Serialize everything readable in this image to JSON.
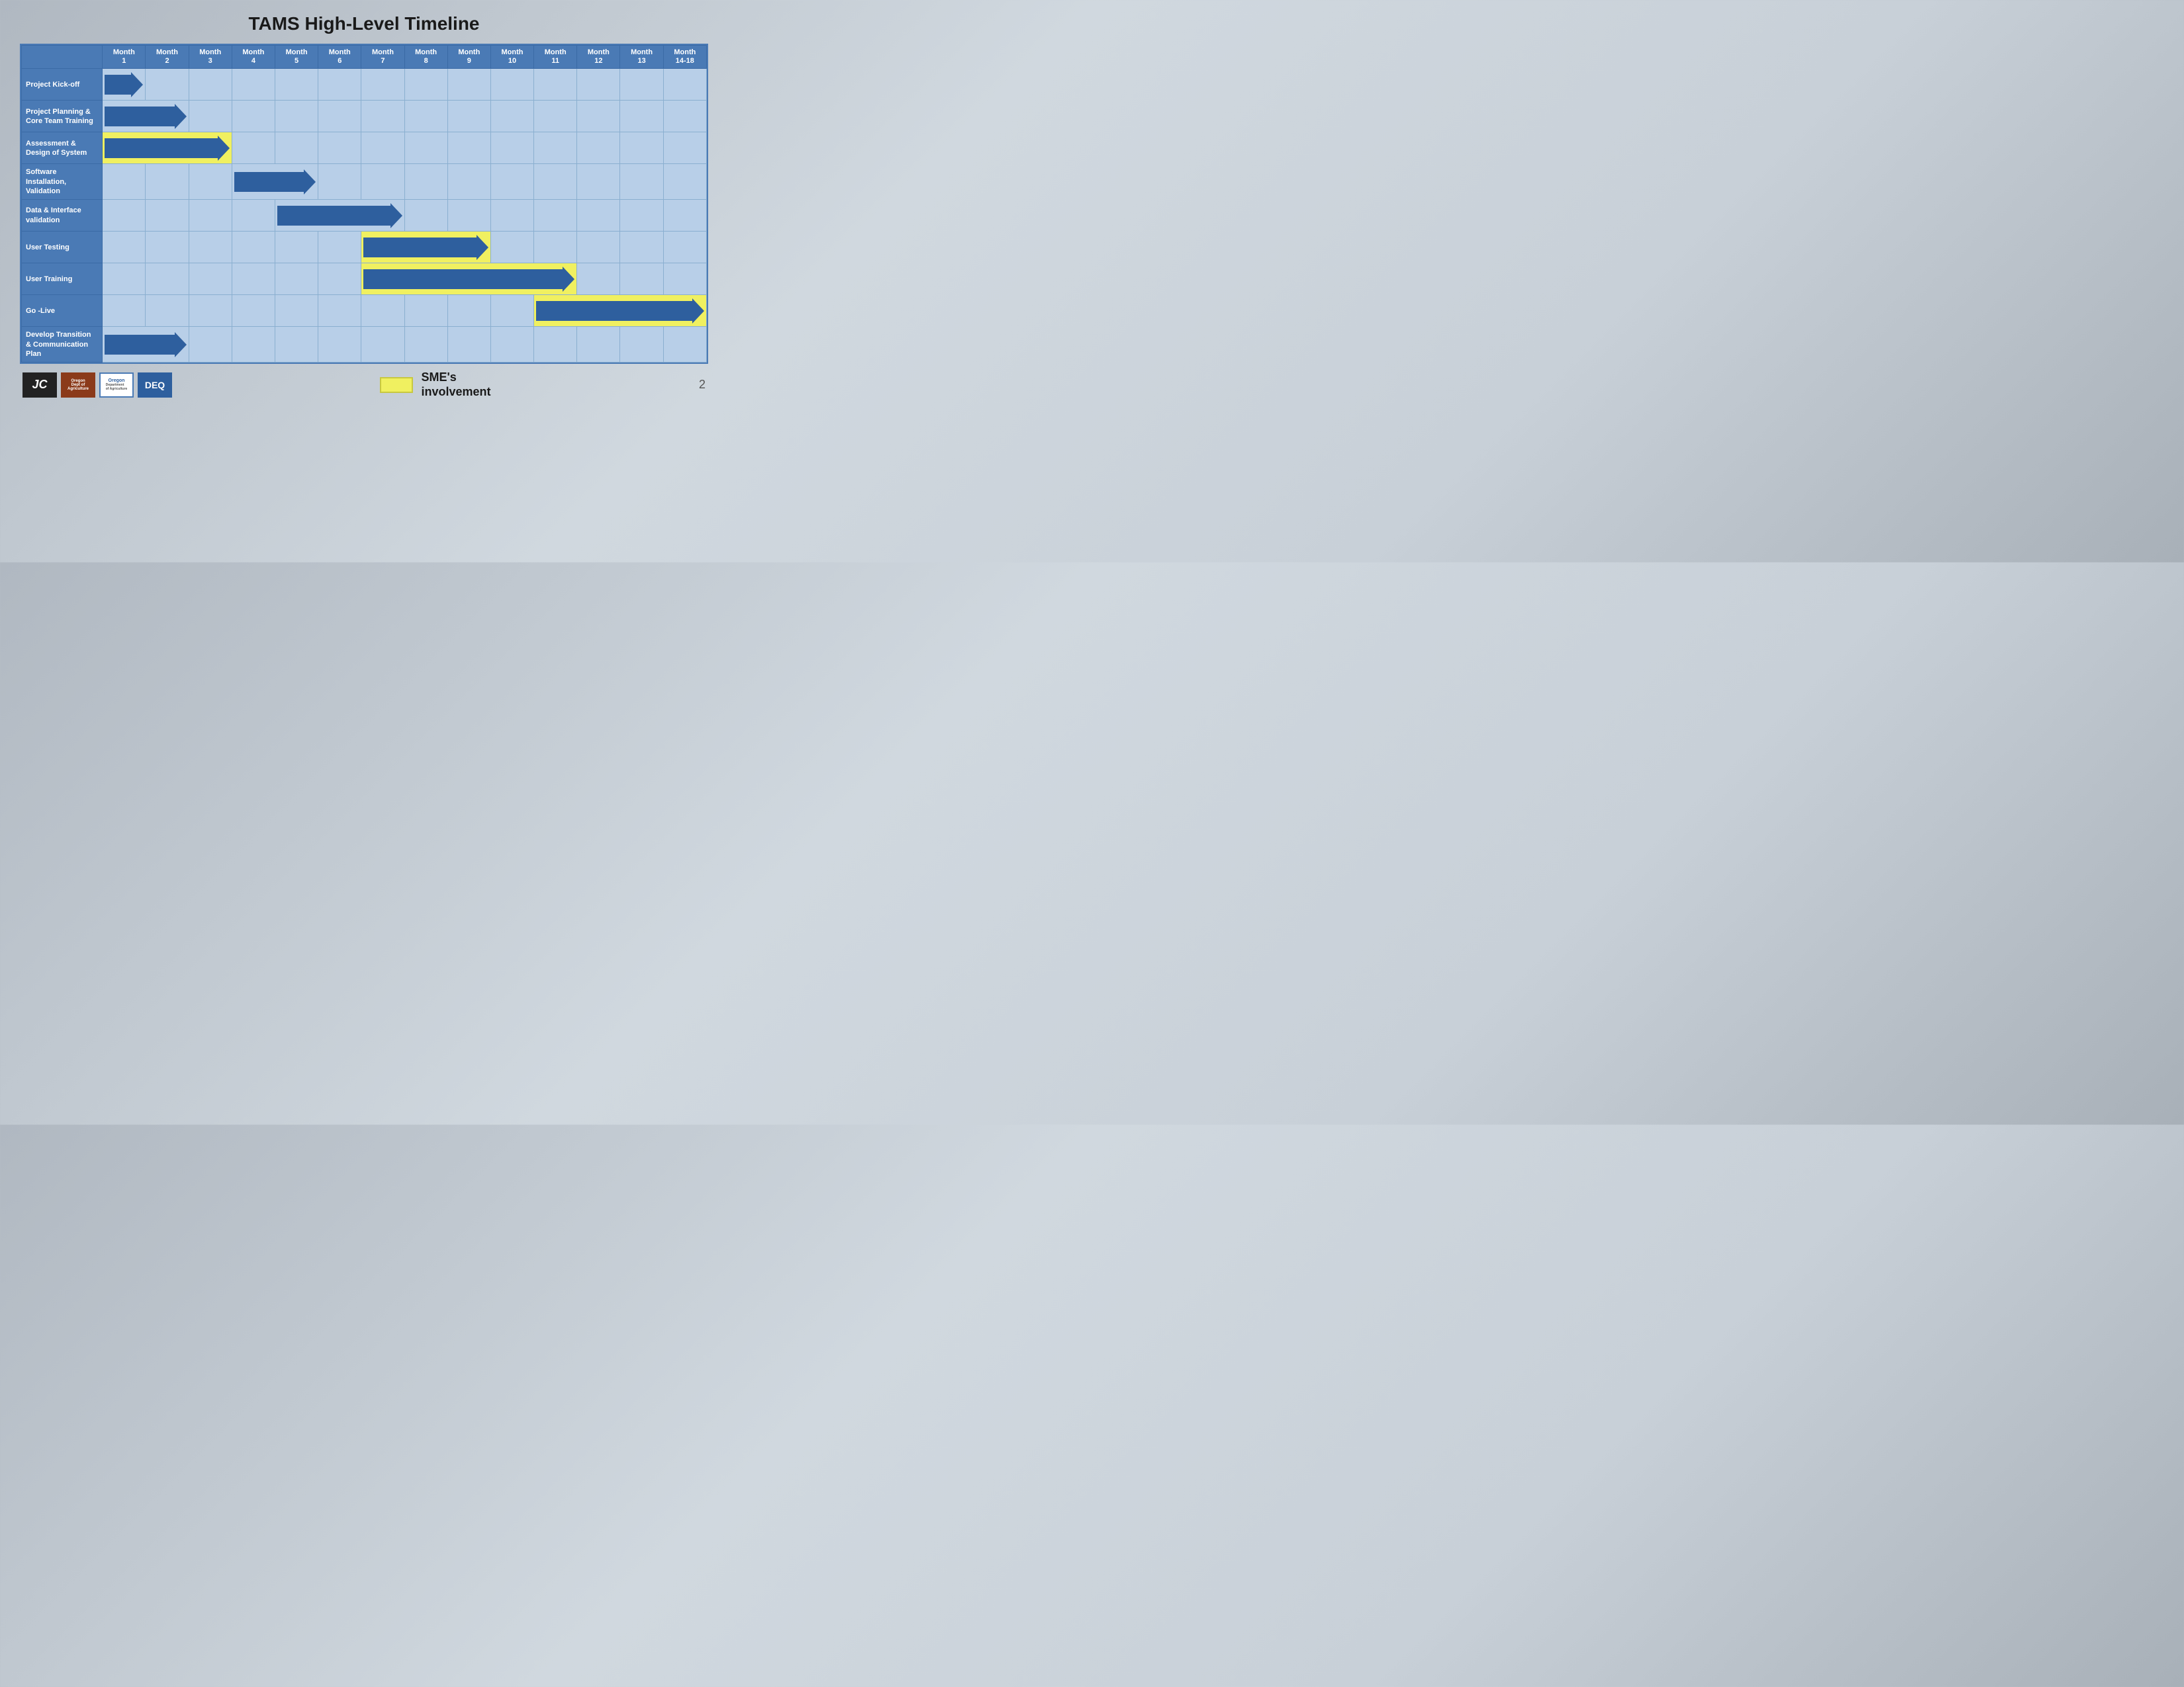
{
  "title": "TAMS High-Level Timeline",
  "months": [
    {
      "label": "Month",
      "sub": "1"
    },
    {
      "label": "Month",
      "sub": "2"
    },
    {
      "label": "Month",
      "sub": "3"
    },
    {
      "label": "Month",
      "sub": "4"
    },
    {
      "label": "Month",
      "sub": "5"
    },
    {
      "label": "Month",
      "sub": "6"
    },
    {
      "label": "Month",
      "sub": "7"
    },
    {
      "label": "Month",
      "sub": "8"
    },
    {
      "label": "Month",
      "sub": "9"
    },
    {
      "label": "Month",
      "sub": "10"
    },
    {
      "label": "Month",
      "sub": "11"
    },
    {
      "label": "Month",
      "sub": "12"
    },
    {
      "label": "Month",
      "sub": "13"
    },
    {
      "label": "Month",
      "sub": "14-18"
    }
  ],
  "rows": [
    {
      "label": "Project Kick-off",
      "arrow_start": 0,
      "arrow_span": 1,
      "yellow": false
    },
    {
      "label": "Project Planning & Core Team Training",
      "arrow_start": 0,
      "arrow_span": 2,
      "yellow": false
    },
    {
      "label": "Assessment & Design of System",
      "arrow_start": 0,
      "arrow_span": 3,
      "yellow": true
    },
    {
      "label": "Software Installation, Validation",
      "arrow_start": 3,
      "arrow_span": 2,
      "yellow": false
    },
    {
      "label": "Data & Interface validation",
      "arrow_start": 4,
      "arrow_span": 3,
      "yellow": false
    },
    {
      "label": "User Testing",
      "arrow_start": 6,
      "arrow_span": 3,
      "yellow": true
    },
    {
      "label": "User Training",
      "arrow_start": 6,
      "arrow_span": 5,
      "yellow": true
    },
    {
      "label": "Go -Live",
      "arrow_start": 10,
      "arrow_span": 4,
      "yellow": true
    },
    {
      "label": "Develop Transition & Communication Plan",
      "arrow_start": 0,
      "arrow_span": 2,
      "yellow": false
    }
  ],
  "legend": {
    "box_label": "",
    "text": "SME's\ninvolvement"
  },
  "page_number": "2",
  "arrow_color": "#2e5f9e"
}
